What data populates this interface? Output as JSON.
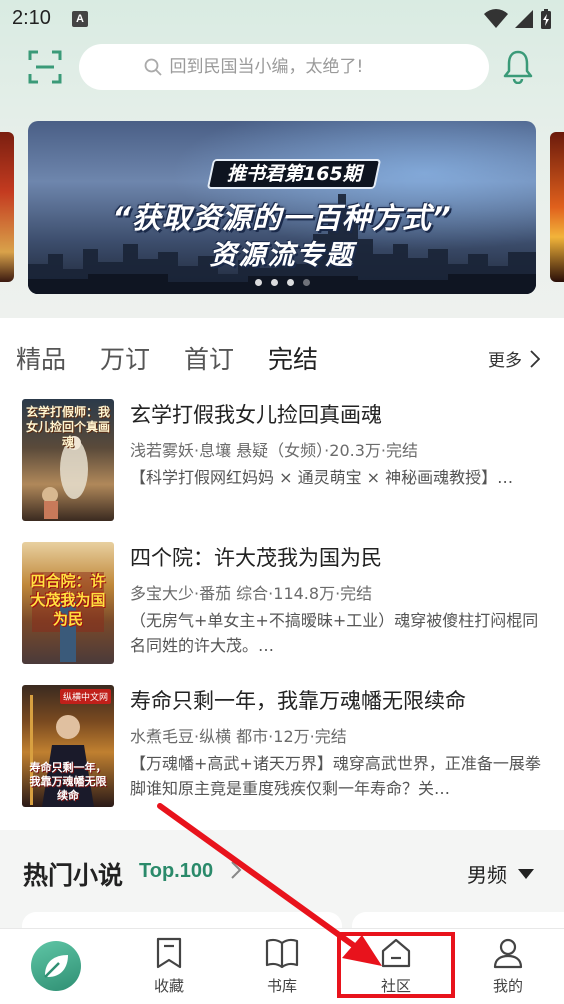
{
  "status_bar": {
    "time": "2:10",
    "notification_badge": "A"
  },
  "search": {
    "placeholder": "回到民国当小编，太绝了!"
  },
  "banner": {
    "tag": "推书君第165期",
    "title": "“获取资源的一百种方式”",
    "subtitle": "资源流专题",
    "dots": 4,
    "active_dot": 3
  },
  "tabs": [
    {
      "label": "精品",
      "active": false
    },
    {
      "label": "万订",
      "active": false
    },
    {
      "label": "首订",
      "active": false
    },
    {
      "label": "完结",
      "active": true
    }
  ],
  "more_label": "更多",
  "books": [
    {
      "title": "玄学打假我女儿捡回真画魂",
      "meta": "浅若雾妖·息壤   悬疑（女频）·20.3万·完结",
      "desc": "【科学打假网红妈妈 × 通灵萌宝 × 神秘画魂教授】…",
      "cover_text": "玄学打假师：我女儿捡回个真画魂"
    },
    {
      "title": "四个院：许大茂我为国为民",
      "meta": "多宝大少·番茄   综合·114.8万·完结",
      "desc": "（无房气+单女主+不搞暧昧+工业）魂穿被傻柱打闷棍同名同姓的许大茂。…",
      "cover_text": "四合院：许大茂我为国为民"
    },
    {
      "title": "寿命只剩一年，我靠万魂幡无限续命",
      "meta": "水煮毛豆·纵横   都市·12万·完结",
      "desc": "【万魂幡+高武+诸天万界】魂穿高武世界，正准备一展拳脚谁知原主竟是重度残疾仅剩一年寿命？关…",
      "cover_text": "寿命只剩一年，我靠万魂幡无限续命",
      "cover_badge": "纵横中文网"
    }
  ],
  "hot": {
    "title": "热门小说",
    "top_label": "Top.100",
    "gender_filter": "男频"
  },
  "bottom_nav": [
    {
      "label": "",
      "icon": "leaf-logo-icon"
    },
    {
      "label": "收藏",
      "icon": "bookmark-icon"
    },
    {
      "label": "书库",
      "icon": "book-icon"
    },
    {
      "label": "社区",
      "icon": "home-icon"
    },
    {
      "label": "我的",
      "icon": "user-icon"
    }
  ],
  "colors": {
    "accent": "#2a8a6a",
    "highlight": "#e8131c",
    "tab_underline": "#f5e08a"
  }
}
